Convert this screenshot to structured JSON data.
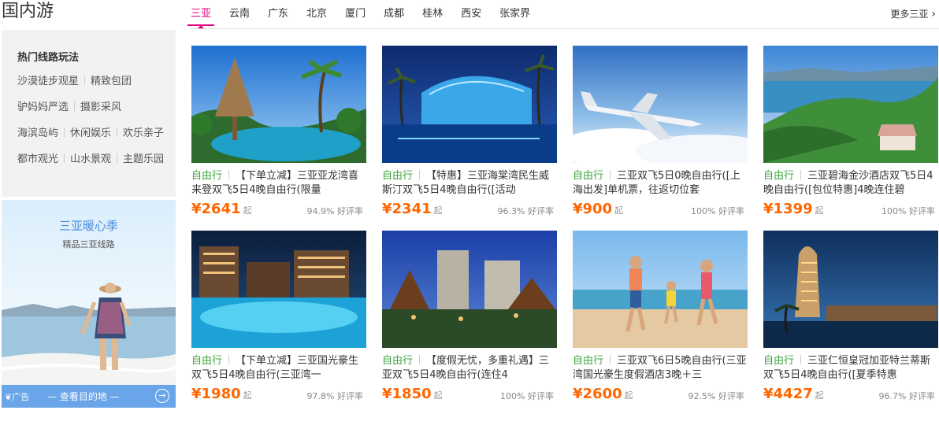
{
  "section_title": "国内游",
  "tabs": [
    "三亚",
    "云南",
    "广东",
    "北京",
    "厦门",
    "成都",
    "桂林",
    "西安",
    "张家界"
  ],
  "active_tab": 0,
  "more_link": "更多三亚",
  "routes": {
    "title": "热门线路玩法",
    "rows": [
      [
        "沙漠徒步观星",
        "精致包团"
      ],
      [
        "驴妈妈严选",
        "摄影采风"
      ],
      [
        "海滨岛屿",
        "休闲娱乐",
        "欢乐亲子"
      ],
      [
        "都市观光",
        "山水景观",
        "主题乐园"
      ]
    ]
  },
  "promo": {
    "title": "三亚暖心季",
    "subtitle": "精品三亚线路",
    "ad_label": "广告",
    "cta": "— 查看目的地 —"
  },
  "cards": [
    {
      "tag": "自由行",
      "title": "【下单立减】三亚亚龙湾喜来登双飞5日4晚自由行(限量",
      "price": "¥2641",
      "qi": "起",
      "rating": "94.9% 好评率",
      "scene": "resort"
    },
    {
      "tag": "自由行",
      "title": "【特惠】三亚海棠湾民生威斯汀双飞5日4晚自由行([活动",
      "price": "¥2341",
      "qi": "起",
      "rating": "96.3% 好评率",
      "scene": "night-pool"
    },
    {
      "tag": "自由行",
      "title": "三亚双飞5日0晚自由行([上海出发]单机票，往返切位套",
      "price": "¥900",
      "qi": "起",
      "rating": "100% 好评率",
      "scene": "plane"
    },
    {
      "tag": "自由行",
      "title": "三亚碧海金沙酒店双飞5日4晚自由行([包位特惠]4晚连住碧",
      "price": "¥1399",
      "qi": "起",
      "rating": "100% 好评率",
      "scene": "bay"
    },
    {
      "tag": "自由行",
      "title": "【下单立减】三亚国光豪生双飞5日4晚自由行(三亚湾一",
      "price": "¥1980",
      "qi": "起",
      "rating": "97.8% 好评率",
      "scene": "hotel-pool"
    },
    {
      "tag": "自由行",
      "title": "【度假无忧，多重礼遇】三亚双飞5日4晚自由行(连住4",
      "price": "¥1850",
      "qi": "起",
      "rating": "100% 好评率",
      "scene": "thai-resort"
    },
    {
      "tag": "自由行",
      "title": "三亚双飞6日5晚自由行(三亚湾国光豪生度假酒店3晚＋三",
      "price": "¥2600",
      "qi": "起",
      "rating": "92.5% 好评率",
      "scene": "family"
    },
    {
      "tag": "自由行",
      "title": "三亚仁恒皇冠加亚特兰蒂斯双飞5日4晚自由行([夏季特惠",
      "price": "¥4427",
      "qi": "起",
      "rating": "96.7% 好评率",
      "scene": "tower"
    }
  ]
}
